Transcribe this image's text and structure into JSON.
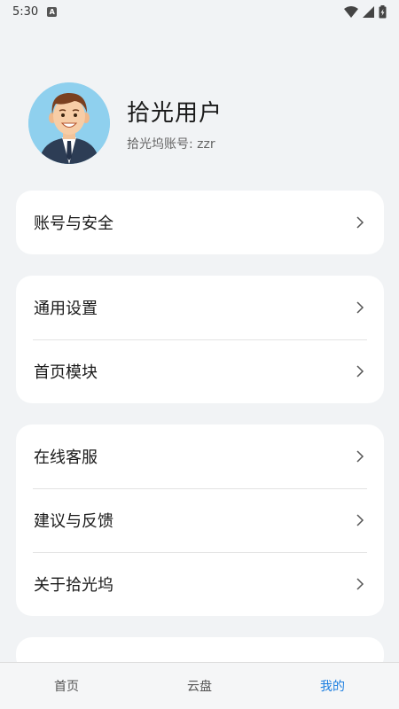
{
  "status_bar": {
    "time": "5:30",
    "notification_icon": "a-icon",
    "icons": [
      "wifi-icon",
      "signal-icon",
      "battery-icon"
    ]
  },
  "profile": {
    "name": "拾光用户",
    "account": "拾光坞账号: zzr",
    "avatar_icon": "man-avatar"
  },
  "groups": [
    {
      "items": [
        {
          "label": "账号与安全"
        }
      ]
    },
    {
      "items": [
        {
          "label": "通用设置"
        },
        {
          "label": "首页模块"
        }
      ]
    },
    {
      "items": [
        {
          "label": "在线客服"
        },
        {
          "label": "建议与反馈"
        },
        {
          "label": "关于拾光坞"
        }
      ]
    }
  ],
  "bottom_nav": {
    "items": [
      {
        "label": "首页"
      },
      {
        "label": "云盘"
      },
      {
        "label": "我的"
      }
    ],
    "active": "我的",
    "active_color": "#1d7fe0"
  }
}
